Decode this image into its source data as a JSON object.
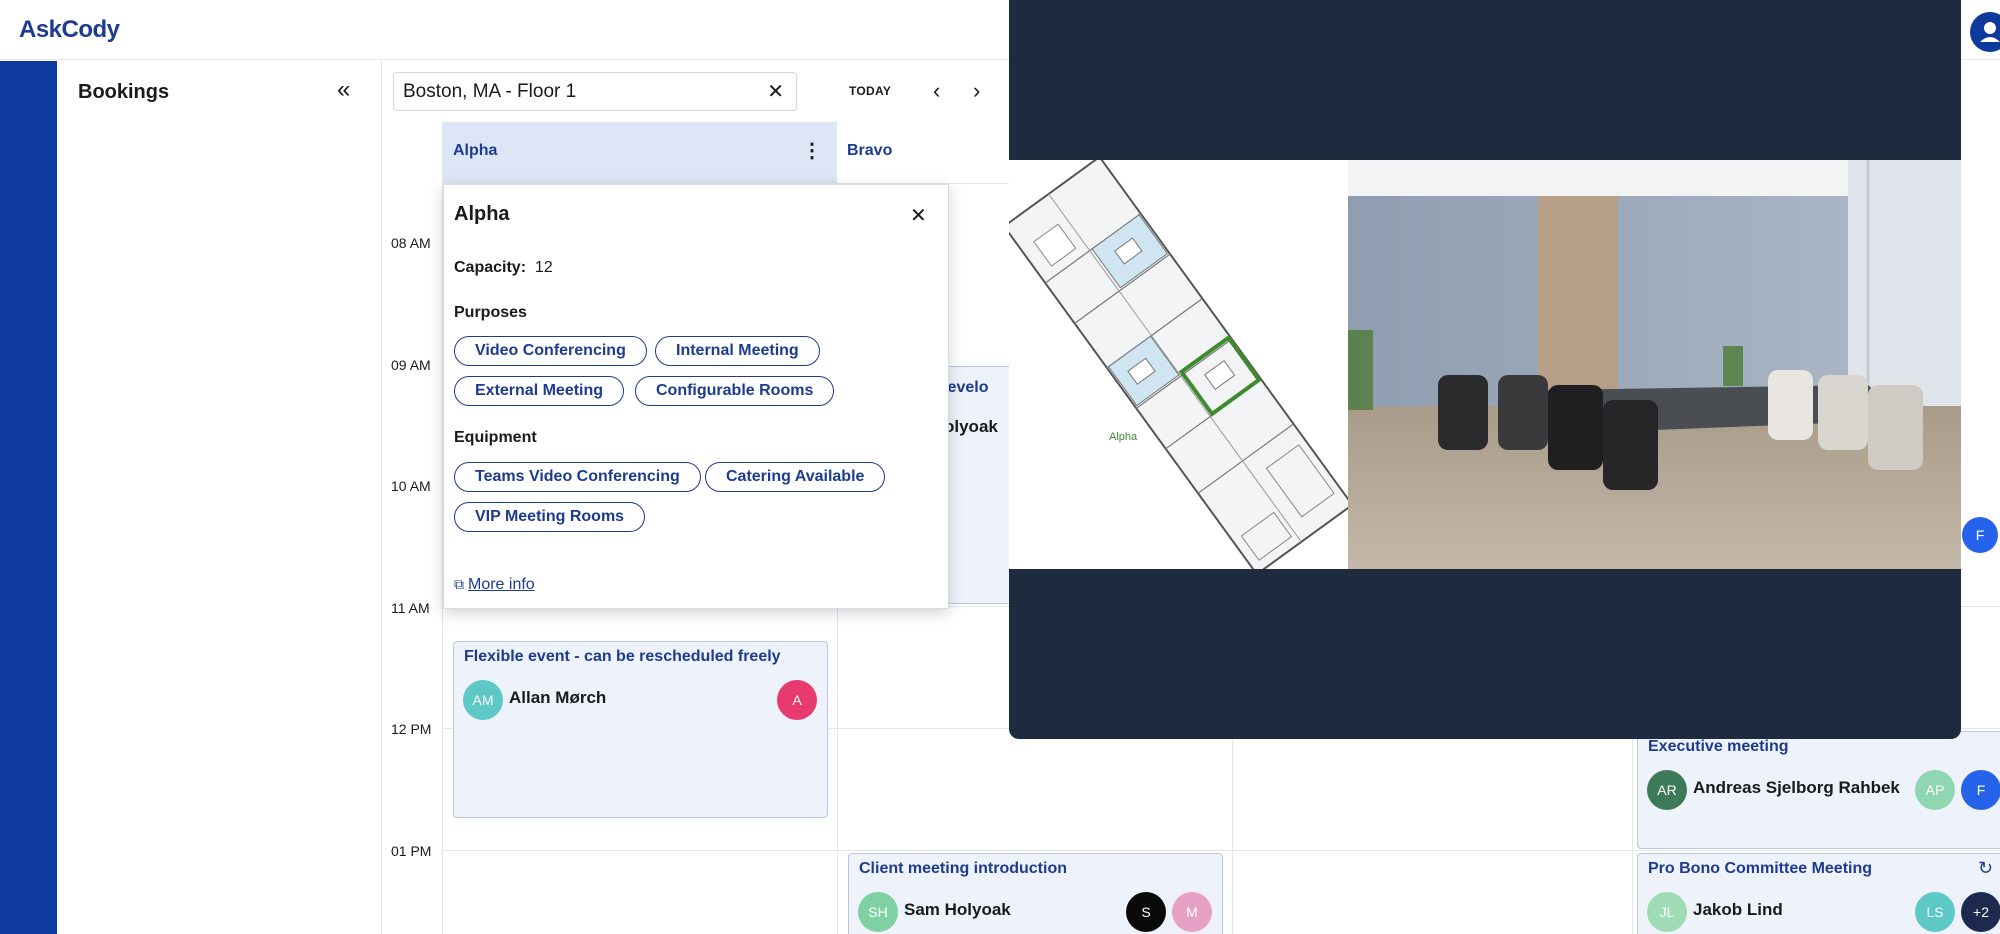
{
  "app": {
    "logo": "AskCody"
  },
  "sidebar": {
    "title": "Bookings",
    "collapse_icon": "chevrons-left-icon"
  },
  "toolbar": {
    "location": "Boston, MA - Floor 1",
    "today_label": "TODAY"
  },
  "calendar": {
    "times": [
      "08 AM",
      "09 AM",
      "10 AM",
      "11 AM",
      "12 PM",
      "01 PM"
    ],
    "columns": [
      "Alpha",
      "Bravo"
    ]
  },
  "popover": {
    "title": "Alpha",
    "capacity_label": "Capacity:",
    "capacity_value": "12",
    "purposes_label": "Purposes",
    "purposes": [
      "Video Conferencing",
      "Internal Meeting",
      "External Meeting",
      "Configurable Rooms"
    ],
    "equipment_label": "Equipment",
    "equipment": [
      "Teams Video Conferencing",
      "Catering Available",
      "VIP Meeting Rooms"
    ],
    "more_info": "More info"
  },
  "events": {
    "flexible": {
      "title": "Flexible event - can be rescheduled freely",
      "organizer": "Allan Mørch",
      "initials": "AM",
      "attendee": "A"
    },
    "bravo_partial": {
      "title_fragment": "Develo",
      "person_fragment": "olyoak"
    },
    "client": {
      "title": "Client meeting introduction",
      "organizer": "Sam Holyoak",
      "initials": "SH",
      "attendees": [
        "S",
        "M"
      ]
    },
    "executive": {
      "title": "Executive meeting",
      "organizer": "Andreas Sjelborg Rahbek",
      "initials": "AR",
      "attendees": [
        "AP",
        "F"
      ]
    },
    "probono": {
      "title": "Pro Bono Committee Meeting",
      "organizer": "Jakob Lind",
      "initials": "JL",
      "attendees": [
        "LS",
        "+2"
      ]
    },
    "edge_badge": "F"
  },
  "floorplan": {
    "room_label": "Alpha"
  },
  "colors": {
    "brand": "#1d3b8f",
    "rail": "#0d3a9c",
    "alpha_header": "#dde6f7",
    "lightbox": "#1e2a3d"
  }
}
